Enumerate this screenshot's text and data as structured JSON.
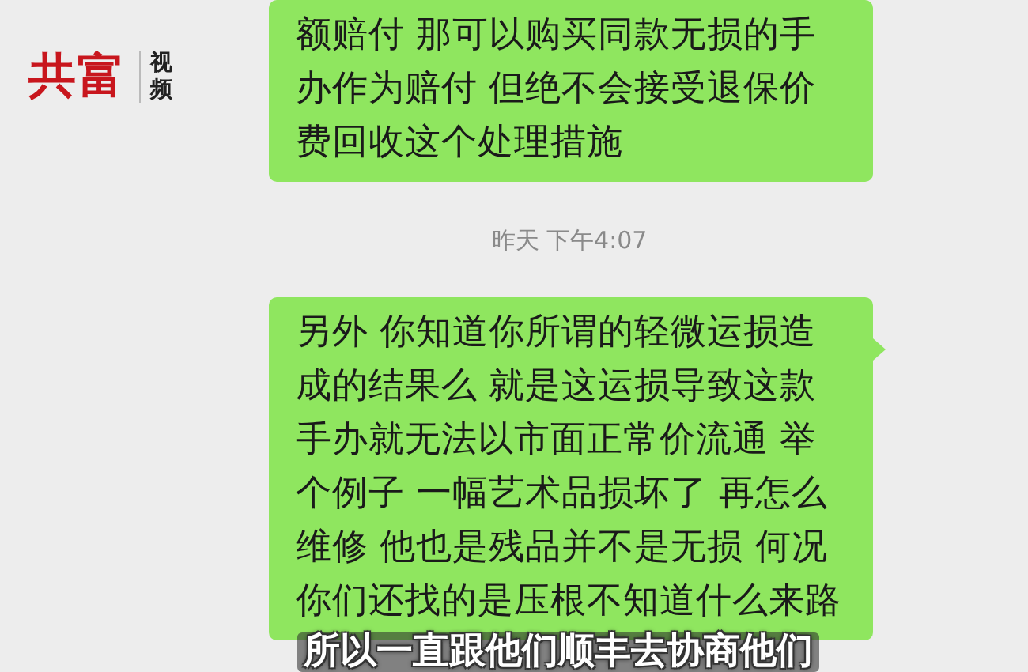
{
  "logo": {
    "name": "共富",
    "sub": "视频"
  },
  "messages": [
    {
      "kind": "bubble",
      "tail": false,
      "lines": [
        "额赔付 那可以购买同款无损的手",
        "办作为赔付 但绝不会接受退保价",
        "费回收这个处理措施"
      ]
    },
    {
      "kind": "time",
      "text": "昨天 下午4:07"
    },
    {
      "kind": "bubble",
      "tail": true,
      "lines": [
        "另外 你知道你所谓的轻微运损造",
        "成的结果么 就是这运损导致这款",
        "手办就无法以市面正常价流通 举",
        "个例子 一幅艺术品损坏了 再怎么",
        "维修 他也是残品并不是无损 何况",
        "你们还找的是压根不知道什么来路"
      ]
    }
  ],
  "subtitle": "所以一直跟他们顺丰去协商他们"
}
